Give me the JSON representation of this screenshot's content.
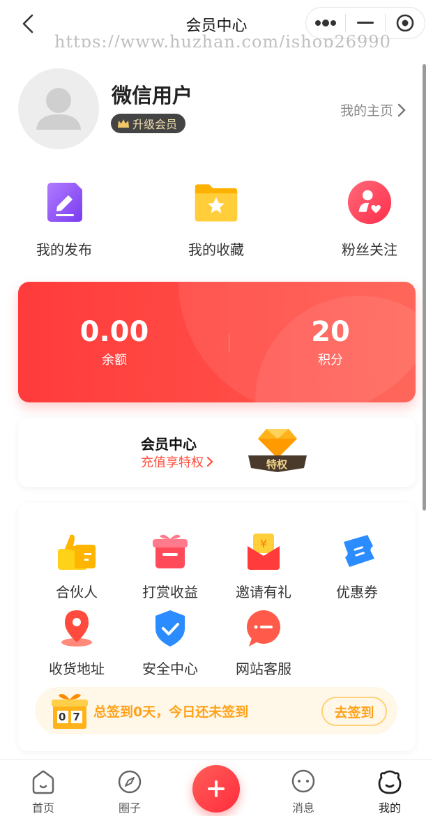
{
  "header": {
    "title": "会员中心",
    "watermark": "https://www.huzhan.com/ishop26990"
  },
  "profile": {
    "username": "微信用户",
    "vip_badge": "升级会员",
    "homepage_link": "我的主页"
  },
  "quick_actions": [
    {
      "label": "我的发布",
      "icon": "edit-doc-icon"
    },
    {
      "label": "我的收藏",
      "icon": "star-folder-icon"
    },
    {
      "label": "粉丝关注",
      "icon": "fans-heart-icon"
    }
  ],
  "balance": {
    "amount": "0.00",
    "amount_label": "余额",
    "points": "20",
    "points_label": "积分"
  },
  "vip_card": {
    "title": "会员中心",
    "subtitle": "充值享特权",
    "privilege_label": "特权"
  },
  "services": [
    {
      "label": "合伙人",
      "icon": "thumbs-up-icon"
    },
    {
      "label": "打赏收益",
      "icon": "gift-box-icon"
    },
    {
      "label": "邀请有礼",
      "icon": "red-envelope-icon"
    },
    {
      "label": "优惠券",
      "icon": "coupon-icon"
    },
    {
      "label": "收货地址",
      "icon": "location-pin-icon"
    },
    {
      "label": "安全中心",
      "icon": "shield-check-icon"
    },
    {
      "label": "网站客服",
      "icon": "chat-bubble-icon"
    }
  ],
  "signin": {
    "text": "总签到0天，今日还未签到",
    "button": "去签到",
    "counter": "07"
  },
  "tabbar": [
    {
      "label": "首页",
      "icon": "home-icon"
    },
    {
      "label": "圈子",
      "icon": "compass-icon"
    },
    {
      "label": "消息",
      "icon": "message-icon"
    },
    {
      "label": "我的",
      "icon": "profile-face-icon"
    }
  ],
  "colors": {
    "accent": "#ff3b3b",
    "sign_accent": "#ffa21a"
  }
}
